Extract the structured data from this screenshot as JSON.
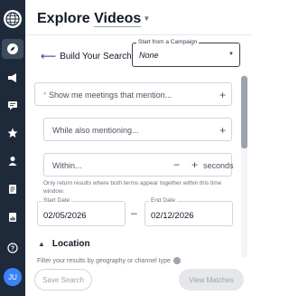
{
  "header": {
    "title_prefix": "Explore",
    "title_selection": "Videos"
  },
  "nav": {
    "back_label": "Build Your Search"
  },
  "campaign": {
    "label": "Start from a Campaign",
    "value": "None"
  },
  "search": {
    "required_mark": "*",
    "meetings_placeholder": "Show me meetings that mention...",
    "also_placeholder": "While also mentioning...",
    "within_placeholder": "Within...",
    "within_unit": "seconds",
    "within_hint": "Only return results where both terms appear together within this time window."
  },
  "dates": {
    "start_label": "Start Date",
    "start_value": "02/05/2026",
    "end_label": "End Date",
    "end_value": "02/12/2026"
  },
  "location": {
    "section_label": "Location",
    "hint": "Filter your results by geography or channel type"
  },
  "footer": {
    "save_label": "Save Search",
    "view_label": "View Matches"
  },
  "user": {
    "initials": "JU"
  },
  "colors": {
    "sidebar_bg": "#1e2a3a",
    "accent": "#1e3a8a",
    "avatar": "#3b82f6"
  }
}
